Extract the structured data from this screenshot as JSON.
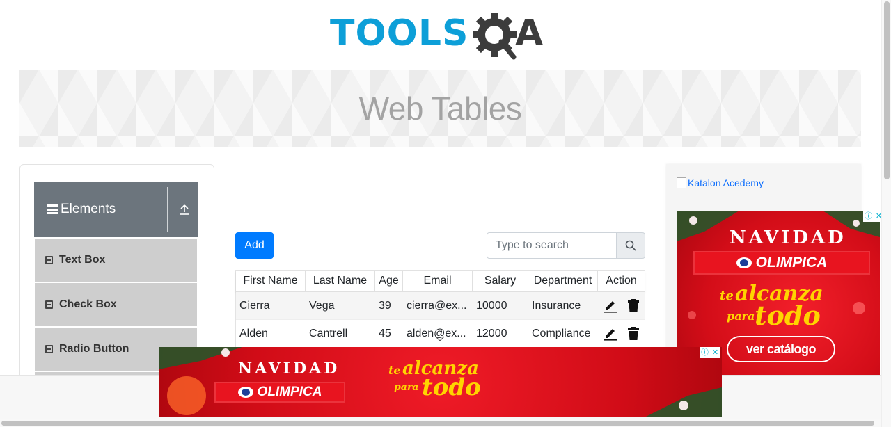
{
  "logo": {
    "left_text": "TOOLS",
    "right_text": "A"
  },
  "banner": {
    "title": "Web Tables"
  },
  "sidebar": {
    "group_title": "Elements",
    "items": [
      {
        "label": "Text Box"
      },
      {
        "label": "Check Box"
      },
      {
        "label": "Radio Button"
      }
    ]
  },
  "toolbar": {
    "add_label": "Add",
    "search_placeholder": "Type to search"
  },
  "table": {
    "columns": [
      "First Name",
      "Last Name",
      "Age",
      "Email",
      "Salary",
      "Department",
      "Action"
    ],
    "rows": [
      {
        "first": "Cierra",
        "last": "Vega",
        "age": "39",
        "email": "cierra@ex...",
        "salary": "10000",
        "department": "Insurance"
      },
      {
        "first": "Alden",
        "last": "Cantrell",
        "age": "45",
        "email": "alden@ex...",
        "salary": "12000",
        "department": "Compliance"
      }
    ]
  },
  "right_panel": {
    "image_alt": "Katalon Acedemy"
  },
  "ad_side": {
    "headline": "NAVIDAD",
    "brand": "OLIMPICA",
    "slogan_small1": "te",
    "slogan_big1": "alcanza",
    "slogan_small2": "para",
    "slogan_big2": "todo",
    "cta": "ver catálogo"
  },
  "ad_bottom": {
    "headline": "NAVIDAD",
    "brand": "OLIMPICA",
    "slogan_small1": "te",
    "slogan_big1": "alcanza",
    "slogan_small2": "para",
    "slogan_big2": "todo"
  },
  "colors": {
    "brand_blue": "#0d9fd8",
    "primary_button": "#007bff",
    "sidebar_header": "#6c757d",
    "ad_red": "#d30d18",
    "ad_yellow": "#ffd400"
  },
  "icons": {
    "menu": "hamburger-icon",
    "collapse": "upload-arrow-icon",
    "search": "search-icon",
    "edit": "pencil-icon",
    "delete": "trash-icon",
    "expand": "chevron-down-icon",
    "ad_info": "info-icon",
    "ad_close": "close-icon"
  }
}
